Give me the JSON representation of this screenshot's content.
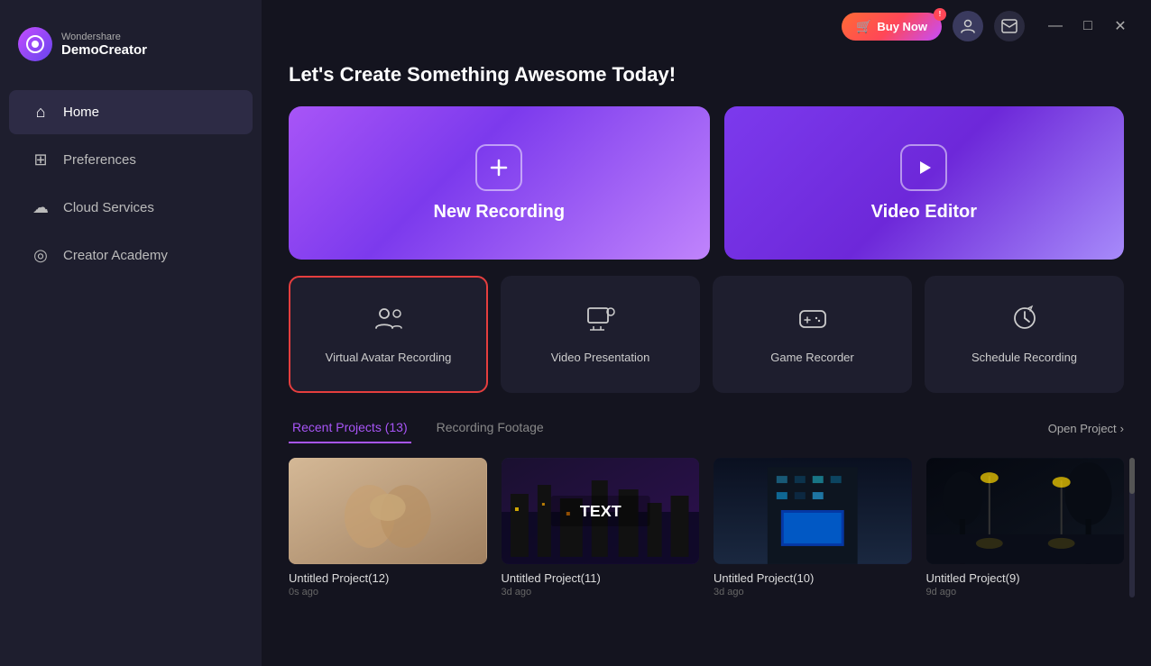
{
  "app": {
    "logo_sub": "Wondershare",
    "logo_main": "DemoCreator"
  },
  "topbar": {
    "buy_now": "Buy Now",
    "minimize": "—",
    "maximize": "□",
    "close": "✕"
  },
  "sidebar": {
    "items": [
      {
        "id": "home",
        "label": "Home",
        "icon": "⌂",
        "active": true
      },
      {
        "id": "preferences",
        "label": "Preferences",
        "icon": "⊞"
      },
      {
        "id": "cloud-services",
        "label": "Cloud Services",
        "icon": "☁"
      },
      {
        "id": "creator-academy",
        "label": "Creator Academy",
        "icon": "◎"
      }
    ]
  },
  "main": {
    "page_title": "Let's Create Something Awesome Today!",
    "hero_cards": [
      {
        "id": "new-recording",
        "icon": "+",
        "label": "New Recording"
      },
      {
        "id": "video-editor",
        "icon": "▷",
        "label": "Video Editor"
      }
    ],
    "feature_cards": [
      {
        "id": "virtual-avatar",
        "label": "Virtual Avatar Recording",
        "selected": true
      },
      {
        "id": "video-presentation",
        "label": "Video Presentation",
        "selected": false
      },
      {
        "id": "game-recorder",
        "label": "Game Recorder",
        "selected": false
      },
      {
        "id": "schedule-recording",
        "label": "Schedule Recording",
        "selected": false
      }
    ],
    "tabs": [
      {
        "id": "recent-projects",
        "label": "Recent Projects (13)",
        "active": true
      },
      {
        "id": "recording-footage",
        "label": "Recording Footage",
        "active": false
      }
    ],
    "open_project": "Open Project",
    "projects": [
      {
        "id": 1,
        "name": "Untitled Project(12)",
        "time": "0s ago",
        "thumb_type": "wedding"
      },
      {
        "id": 2,
        "name": "Untitled Project(11)",
        "time": "3d ago",
        "thumb_type": "city-night"
      },
      {
        "id": 3,
        "name": "Untitled Project(10)",
        "time": "3d ago",
        "thumb_type": "blue-building"
      },
      {
        "id": 4,
        "name": "Untitled Project(9)",
        "time": "9d ago",
        "thumb_type": "street-night"
      }
    ]
  }
}
